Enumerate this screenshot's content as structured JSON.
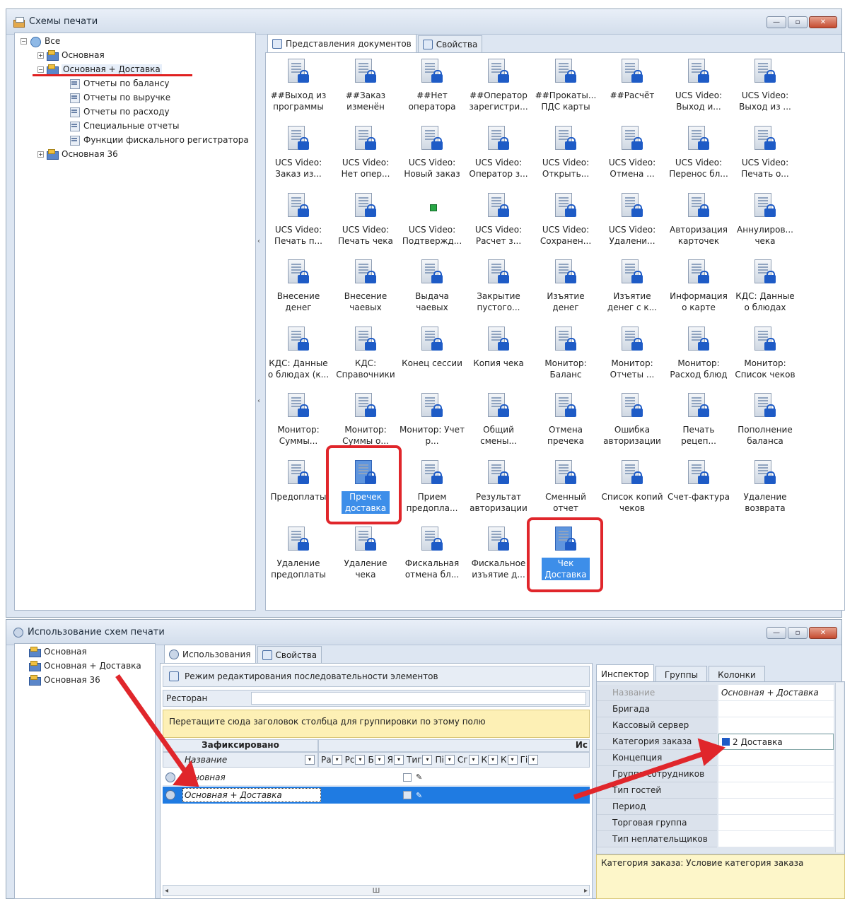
{
  "window1": {
    "title": "Схемы печати",
    "tree": [
      {
        "label": "Все"
      },
      {
        "label": "Основная"
      },
      {
        "label": "Основная + Доставка"
      },
      {
        "label": "Отчеты по балансу"
      },
      {
        "label": "Отчеты по выручке"
      },
      {
        "label": "Отчеты по расходу"
      },
      {
        "label": "Специальные отчеты"
      },
      {
        "label": "Функции фискального регистратора"
      },
      {
        "label": "Основная 36"
      }
    ],
    "tabs": [
      "Представления документов",
      "Свойства"
    ],
    "documents": [
      [
        "##Выход из программы",
        "##Заказ изменён",
        "##Нет оператора",
        "##Оператор зарегистри...",
        "##Прокаты... ПДС карты",
        "##Расчёт",
        "UCS Video: Выход и...",
        "UCS Video: Выход из ..."
      ],
      [
        "UCS Video: Заказ из...",
        "UCS Video: Нет опер...",
        "UCS Video: Новый заказ",
        "UCS Video: Оператор з...",
        "UCS Video: Открыть...",
        "UCS Video: Отмена ...",
        "UCS Video: Перенос бл...",
        "UCS Video: Печать о..."
      ],
      [
        "UCS Video: Печать п...",
        "UCS Video: Печать чека",
        "UCS Video: Подтвержд...",
        "UCS Video: Расчет з...",
        "UCS Video: Сохранен...",
        "UCS Video: Удалени...",
        "Авторизация карточек",
        "Аннулиров... чека"
      ],
      [
        "Внесение денег",
        "Внесение чаевых",
        "Выдача чаевых",
        "Закрытие пустого...",
        "Изъятие денег",
        "Изъятие денег с к...",
        "Информация о карте",
        "КДС: Данные о блюдах"
      ],
      [
        "КДС: Данные о блюдах (к...",
        "КДС: Справочники",
        "Конец сессии",
        "Копия чека",
        "Монитор: Баланс",
        "Монитор: Отчеты ...",
        "Монитор: Расход блюд",
        "Монитор: Список чеков"
      ],
      [
        "Монитор: Суммы...",
        "Монитор: Суммы о...",
        "Монитор: Учет р...",
        "Общий смены...",
        "Отмена пречека",
        "Ошибка авторизации",
        "Печать рецеп...",
        "Пополнение баланса"
      ],
      [
        "Предоплаты",
        "Пречек доставка",
        "Прием предопла...",
        "Результат авторизации",
        "Сменный отчет",
        "Список копий чеков",
        "Счет-фактура",
        "Удаление возврата"
      ],
      [
        "Удаление предоплаты",
        "Удаление чека",
        "Фискальная отмена бл...",
        "Фискальное изъятие д...",
        "Чек Доставка"
      ]
    ]
  },
  "window2": {
    "title": "Использование схем печати",
    "tree": [
      "Основная",
      "Основная + Доставка",
      "Основная 36"
    ],
    "tabs": [
      "Использования",
      "Свойства"
    ],
    "mode_label": "Режим редактирования последовательности элементов",
    "filter_label": "Ресторан",
    "group_hint": "Перетащите сюда заголовок столбца для группировки по этому полю",
    "fixed_header": "Зафиксировано",
    "right_header": "Ис",
    "name_column": "Название",
    "columns": [
      "Ра",
      "Рс",
      "Б",
      "Я",
      "Тиг",
      "Пі",
      "Сг",
      "К",
      "К",
      "Гі"
    ],
    "rows": [
      "Основная",
      "Основная + Доставка"
    ],
    "scroll_text": "Ш"
  },
  "inspector": {
    "tabs": [
      "Инспектор",
      "Группы",
      "Колонки"
    ],
    "properties": [
      {
        "name": "Название",
        "value": "Основная + Доставка"
      },
      {
        "name": "Бригада",
        "value": ""
      },
      {
        "name": "Кассовый сервер",
        "value": ""
      },
      {
        "name": "Категория заказа",
        "value": "2 Доставка"
      },
      {
        "name": "Концепция",
        "value": ""
      },
      {
        "name": "Группа сотрудников",
        "value": ""
      },
      {
        "name": "Тип гостей",
        "value": ""
      },
      {
        "name": "Период",
        "value": ""
      },
      {
        "name": "Торговая группа",
        "value": ""
      },
      {
        "name": "Тип неплательщиков",
        "value": ""
      }
    ],
    "description": "Категория заказа: Условие категория заказа"
  },
  "colors": {
    "highlight": "#3d8ee9",
    "annotation": "#e0262b",
    "hint_bg": "#fdf0b5"
  }
}
